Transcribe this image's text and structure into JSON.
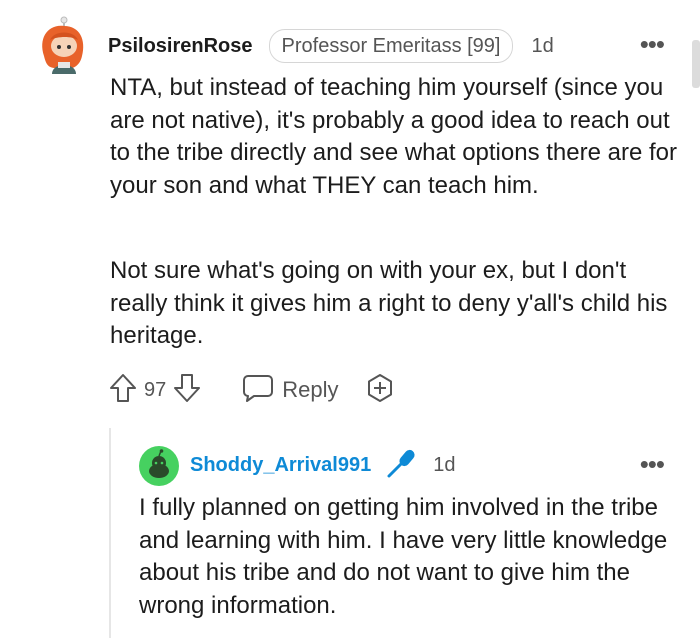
{
  "comment": {
    "author": "PsilosirenRose",
    "flair": "Professor Emeritass [99]",
    "time": "1d",
    "more_label": "•••",
    "paragraphs": [
      "NTA, but instead of teaching him yourself (since you are not native), it's probably a good idea to reach out to the tribe directly and see what options there are for your son and what THEY can teach him.",
      "Not sure what's going on with your ex, but I don't really think it gives him a right to deny y'all's child his heritage."
    ],
    "vote_count": "97",
    "reply_label": "Reply",
    "icons": [
      "avatar-icon",
      "upvote-icon",
      "downvote-icon",
      "reply-bubble-icon",
      "award-add-icon",
      "more-options-icon"
    ]
  },
  "reply": {
    "author": "Shoddy_Arrival991",
    "time": "1d",
    "more_label": "•••",
    "text": "I fully planned on getting him involved in the tribe and learning with him. I have very little knowledge about his tribe and do not want to give him the wrong information.",
    "icons": [
      "snoo-avatar-icon",
      "microphone-icon",
      "more-options-icon"
    ]
  },
  "colors": {
    "username_link": "#0e8ad6",
    "muted": "#555555",
    "text": "#1c1c1c",
    "avatar_hair": "#e8622a",
    "reply_avatar_bg": "#46d160"
  }
}
